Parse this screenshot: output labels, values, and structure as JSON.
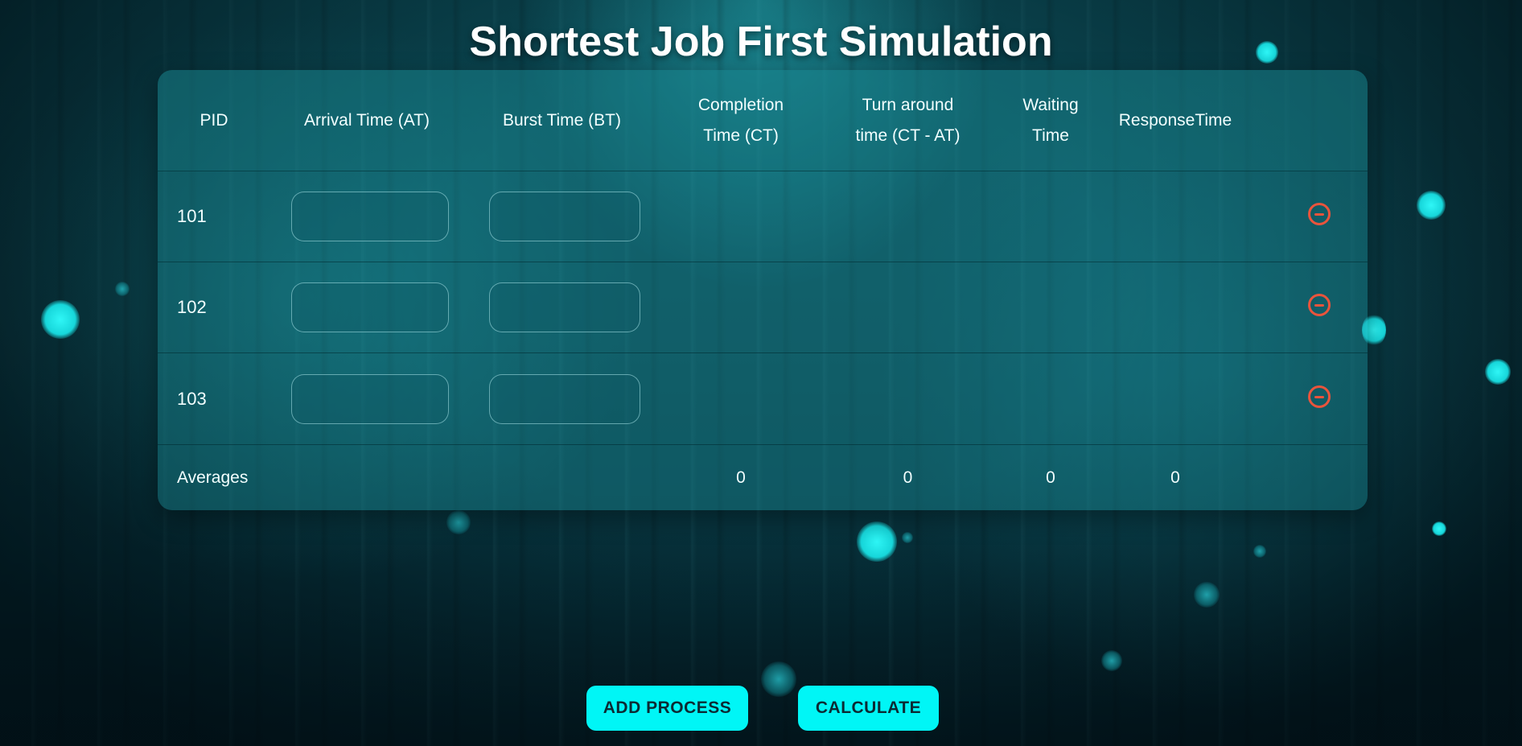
{
  "title": "Shortest Job First Simulation",
  "accent_color": "#00f6f6",
  "remove_color": "#e9543c",
  "table": {
    "headers": {
      "pid": "PID",
      "arrival": "Arrival Time (AT)",
      "burst": "Burst Time (BT)",
      "completion_1": "Completion",
      "completion_2": "Time (CT)",
      "turnaround_1": "Turn around",
      "turnaround_2": "time (CT - AT)",
      "waiting_1": "Waiting",
      "waiting_2": "Time",
      "response": "ResponseTime"
    },
    "rows": [
      {
        "pid": "101",
        "arrival_value": "",
        "burst_value": ""
      },
      {
        "pid": "102",
        "arrival_value": "",
        "burst_value": ""
      },
      {
        "pid": "103",
        "arrival_value": "",
        "burst_value": ""
      }
    ],
    "averages": {
      "label": "Averages",
      "completion": "0",
      "turnaround": "0",
      "waiting": "0",
      "response": "0"
    },
    "remove_icon": "minus-circle-icon"
  },
  "buttons": {
    "add_process": "ADD PROCESS",
    "calculate": "CALCULATE"
  }
}
